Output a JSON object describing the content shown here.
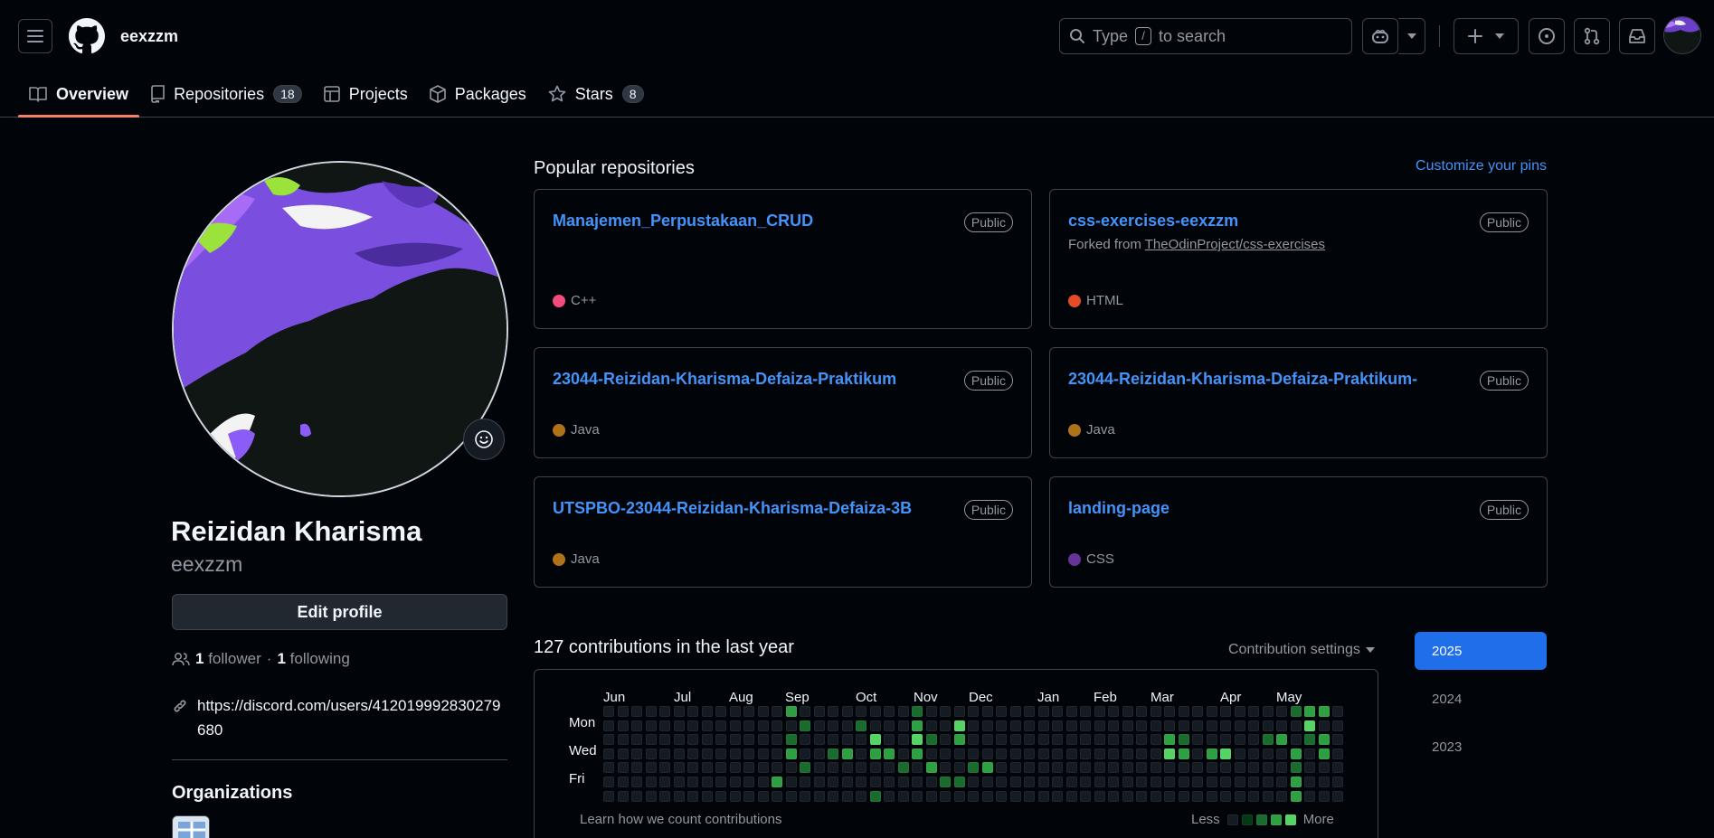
{
  "header": {
    "username": "eexzzm",
    "search_placeholder_prefix": "Type",
    "search_key": "/",
    "search_placeholder_suffix": "to search"
  },
  "tabs": [
    {
      "label": "Overview",
      "icon": "book-icon"
    },
    {
      "label": "Repositories",
      "icon": "repo-icon",
      "count": "18"
    },
    {
      "label": "Projects",
      "icon": "table-icon"
    },
    {
      "label": "Packages",
      "icon": "package-icon"
    },
    {
      "label": "Stars",
      "icon": "star-icon",
      "count": "8"
    }
  ],
  "profile": {
    "full_name": "Reizidan Kharisma",
    "login": "eexzzm",
    "edit_label": "Edit profile",
    "followers_count": "1",
    "followers_label": "follower",
    "separator": "·",
    "following_count": "1",
    "following_label": "following",
    "link": "https://discord.com/users/412019992830279680",
    "organizations_title": "Organizations"
  },
  "popular": {
    "title": "Popular repositories",
    "customize": "Customize your pins",
    "repos": [
      {
        "name": "Manajemen_Perpustakaan_CRUD",
        "badge": "Public",
        "lang": "C++",
        "color": "#f34b7d"
      },
      {
        "name": "css-exercises-eexzzm",
        "badge": "Public",
        "forked_prefix": "Forked from",
        "forked_from": "TheOdinProject/css-exercises",
        "lang": "HTML",
        "color": "#e34c26"
      },
      {
        "name": "23044-Reizidan-Kharisma-Defaiza-Praktikum",
        "badge": "Public",
        "lang": "Java",
        "color": "#b07219"
      },
      {
        "name": "23044-Reizidan-Kharisma-Defaiza-Praktikum-",
        "badge": "Public",
        "lang": "Java",
        "color": "#b07219"
      },
      {
        "name": "UTSPBO-23044-Reizidan-Kharisma-Defaiza-3B",
        "badge": "Public",
        "lang": "Java",
        "color": "#b07219"
      },
      {
        "name": "landing-page",
        "badge": "Public",
        "lang": "CSS",
        "color": "#663399"
      }
    ]
  },
  "contributions": {
    "title": "127 contributions in the last year",
    "settings": "Contribution settings",
    "months": [
      "Jun",
      "Jul",
      "Aug",
      "Sep",
      "Oct",
      "Nov",
      "Dec",
      "Jan",
      "Feb",
      "Mar",
      "Apr",
      "May"
    ],
    "days": [
      "Mon",
      "Wed",
      "Fri"
    ],
    "learn": "Learn how we count contributions",
    "less": "Less",
    "more": "More",
    "years": [
      "2025",
      "2024",
      "2023"
    ],
    "selected_year": "2025",
    "level_colors": [
      "#151b23",
      "#033a16",
      "#196c2e",
      "#2ea043",
      "#56d364"
    ]
  }
}
